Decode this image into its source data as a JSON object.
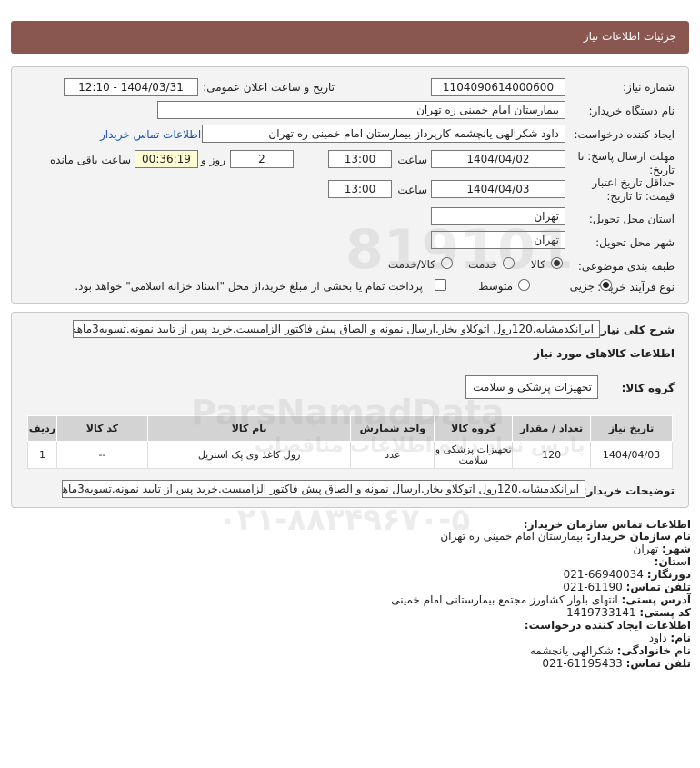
{
  "header": {
    "title": "جزئیات اطلاعات نیاز"
  },
  "fields": {
    "need_number_label": "شماره نیاز:",
    "need_number": "1104090614000600",
    "announce_label": "تاریخ و ساعت اعلان عمومی:",
    "announce_value": "1404/03/31 - 12:10",
    "buyer_label": "نام دستگاه خریدار:",
    "buyer_value": "بیمارستان امام خمینی ره  تهران",
    "requester_label": "ایجاد کننده درخواست:",
    "requester_value": "داود شکرالهی یانچشمه کارپرداز بیمارستان امام خمینی ره  تهران",
    "contact_link": "اطلاعات تماس خریدار",
    "deadline_label_1": "مهلت ارسال پاسخ: تا",
    "deadline_label_2": "تاریخ:",
    "deadline_date": "1404/04/02",
    "time_label": "ساعت",
    "deadline_time": "13:00",
    "days_value": "2",
    "days_label": "روز و",
    "remaining_time": "00:36:19",
    "remaining_label": "ساعت باقی مانده",
    "validity_label_1": "حداقل تاریخ اعتبار",
    "validity_label_2": "قیمت: تا تاریخ:",
    "validity_date": "1404/04/03",
    "validity_time": "13:00",
    "province_label": "استان محل تحویل:",
    "province_value": "تهران",
    "city_label": "شهر محل تحویل:",
    "city_value": "تهران",
    "category_label": "طبقه بندی موضوعی:",
    "category_options": [
      "کالا",
      "خدمت",
      "کالا/خدمت"
    ],
    "category_selected": "کالا",
    "process_label": "نوع فرآیند خرید :",
    "process_options": [
      "جزیی",
      "متوسط"
    ],
    "process_selected": "جزیی",
    "payment_note": "پرداخت تمام یا بخشی از مبلغ خرید،از محل \"اسناد خزانه اسلامی\" خواهد بود."
  },
  "description": {
    "label": "شرح کلی نیاز:",
    "text": "ایرانکدمشابه.120رول اتوکلاو بخار.ارسال نمونه و الصاق پیش فاکتور الزامیست.خرید پس از تایید نمونه.تسویه3ماهه"
  },
  "goods": {
    "section_title": "اطلاعات کالاهای مورد نیاز",
    "group_label": "گروه کالا:",
    "group_value": "تجهیزات پزشکی و سلامت",
    "columns": [
      "ردیف",
      "کد کالا",
      "نام کالا",
      "واحد شمارش",
      "گروه کالا",
      "تعداد / مقدار",
      "تاریخ نیاز"
    ],
    "rows": [
      {
        "row": "1",
        "code": "--",
        "name": "رول کاغذ وی پک استریل",
        "unit": "عدد",
        "group": "تجهیزات پزشکی و سلامت",
        "qty": "120",
        "date": "1404/04/03"
      }
    ],
    "buyer_notes_label": "توضیحات خریدار:",
    "buyer_notes": "ایرانکدمشابه.120رول اتوکلاو بخار.ارسال نمونه و الصاق پیش فاکتور الزامیست.خرید پس از تایید نمونه.تسویه3ماهه"
  },
  "contact": {
    "title": "اطلاعات تماس سازمان خریدار:",
    "org_label": "نام سازمان خریدار:",
    "org_value": "بیمارستان امام خمینی ره تهران",
    "city_label": "شهر:",
    "city_value": "تهران",
    "province_label": "استان:",
    "province_value": "",
    "fax_label": "دورنگار:",
    "fax_value": "021-66940034",
    "phone_label": "تلفن تماس:",
    "phone_value": "021-61190",
    "address_label": "آدرس پستی:",
    "address_value": "انتهای بلوار کشاورز مجتمع بیمارستانی امام خمینی",
    "postal_label": "کد پستی:",
    "postal_value": "1419733141",
    "creator_title": "اطلاعات ایجاد کننده درخواست:",
    "name_label": "نام:",
    "name_value": "داود",
    "family_label": "نام خانوادگی:",
    "family_value": "شکرالهی یانچشمه",
    "creator_phone_label": "تلفن تماس:",
    "creator_phone_value": "021-61195433"
  },
  "watermark": {
    "digits": "819101",
    "brand": "ParsNamadData",
    "tagline": "پارس نماد داده اطلاعات مناقصات",
    "phone": "۰۲۱-۸۸۳۴۹۶۷۰-۵"
  }
}
